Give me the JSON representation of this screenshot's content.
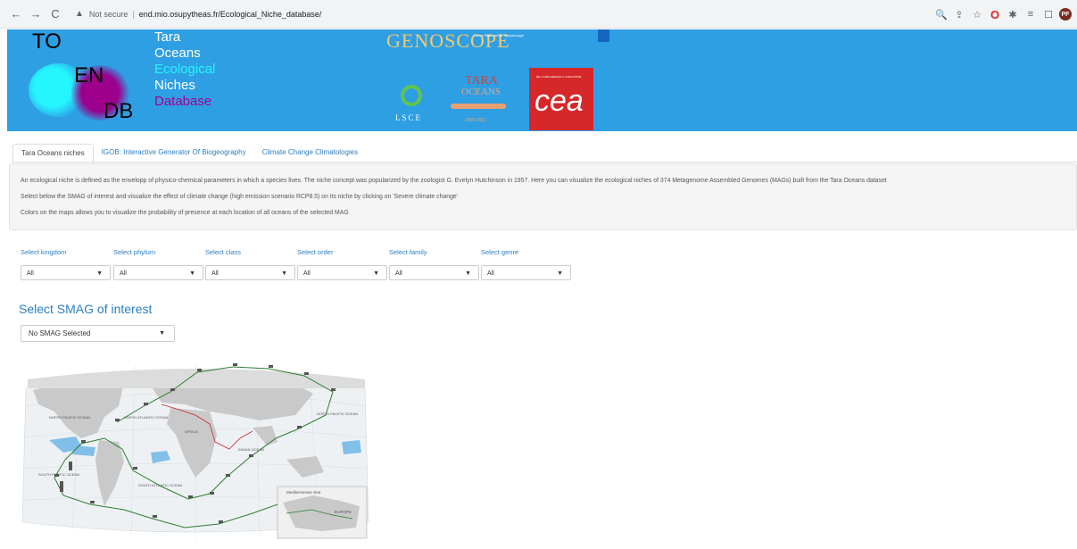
{
  "browser": {
    "back_icon": "←",
    "forward_icon": "→",
    "reload_icon": "C",
    "warning_icon": "▲",
    "not_secure": "Not secure",
    "separator": "|",
    "url": "end.mio.osupytheas.fr/Ecological_Niche_database/",
    "icons": {
      "zoom": "🔍",
      "share": "⇪",
      "star": "☆",
      "opera": "O",
      "extensions": "✱",
      "reading_list": "≡",
      "window": "☐",
      "profile": "PF"
    }
  },
  "banner": {
    "logo_letters": {
      "to": "TO",
      "en": "EN",
      "db": "DB"
    },
    "brand_lines": [
      {
        "text": "Tara",
        "color": "#ffffff"
      },
      {
        "text": "Oceans",
        "color": "#ffffff"
      },
      {
        "text": "Ecological",
        "color": "#25f5ff"
      },
      {
        "text": "Niches",
        "color": "#ffffff"
      },
      {
        "text": "Database",
        "color": "#a2008e"
      }
    ],
    "genoscope": "GENOSCOPE",
    "genoscope_sub": "Centre National de Séquençage",
    "lsce": "LSCE",
    "tara_title": "TARA",
    "tara_sub": "OCEANS",
    "tara_years": "2009-2013",
    "cea_small": "DE LA RECHERCHE À L'INDUSTRIE",
    "cea": "cea"
  },
  "tabs": [
    {
      "label": "Tara Oceans niches",
      "active": true
    },
    {
      "label": "IGOB: Interactive Generator Of Biogeography",
      "active": false
    },
    {
      "label": "Climate Change Climatologies",
      "active": false
    }
  ],
  "description": {
    "line1": "An ecological niche is defined as the envelopp of physico-chemical parameters in which a species lives. The niche concept was popularized by the zoologist G. Evelyn Hutchinson in 1957. Here you can visualize the ecological niches of 374 Metagenome Assembled Genomes (MAGs) built from the Tara Oceans dataset",
    "line2": "Select below the SMAG of interest and visualize the effect of climate change (high emission scenario RCP8.5) on its niche by clicking on 'Severe climate change'",
    "line3": "Colors on the maps allows you to visualize the probability of presence at each location of all oceans of the selected MAG"
  },
  "filters": [
    {
      "label": "Select kingdom",
      "value": "All"
    },
    {
      "label": "Select phylum",
      "value": "All"
    },
    {
      "label": "Select class",
      "value": "All"
    },
    {
      "label": "Select order",
      "value": "All"
    },
    {
      "label": "Select family",
      "value": "All"
    },
    {
      "label": "Select genre",
      "value": "All"
    }
  ],
  "smag": {
    "title": "Select SMAG of interest",
    "selected": "No SMAG Selected"
  },
  "map": {
    "ocean_labels": [
      "NORTH PACIFIC OCEAN",
      "NORTH ATLANTIC OCEAN",
      "SOUTH ATLANTIC OCEAN",
      "INDIAN OCEAN",
      "SOUTH PACIFIC OCEAN",
      "NORTH PACIFIC OCEAN",
      "Mediterranean Sea",
      "EUROPE",
      "AFRICA"
    ]
  }
}
